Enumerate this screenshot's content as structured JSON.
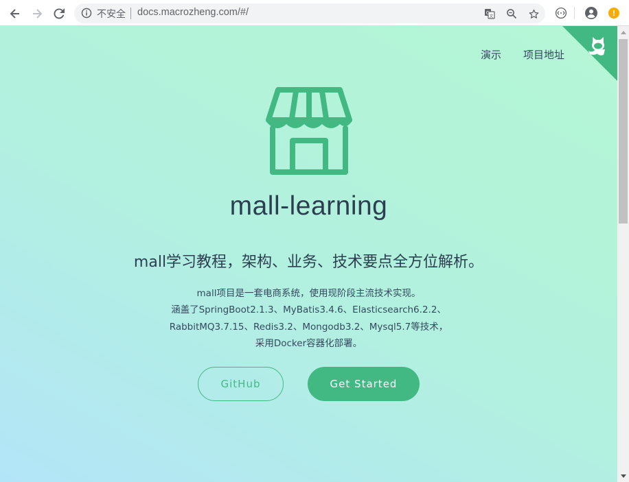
{
  "browser": {
    "security_label": "不安全",
    "url": "docs.macrozheng.com/#/",
    "profile_badge": "!"
  },
  "page": {
    "nav": {
      "demo": "演示",
      "project": "项目地址"
    },
    "title": "mall-learning",
    "tagline": "mall学习教程，架构、业务、技术要点全方位解析。",
    "description": [
      "mall项目是一套电商系统，使用现阶段主流技术实现。",
      "涵盖了SpringBoot2.1.3、MyBatis3.4.6、Elasticsearch6.2.2、",
      "RabbitMQ3.7.15、Redis3.2、Mongodb3.2、Mysql5.7等技术，",
      "采用Docker容器化部署。"
    ],
    "buttons": {
      "github": "GitHub",
      "get_started": "Get Started"
    }
  },
  "colors": {
    "accent": "#42b983",
    "text_dark": "#2c3e50",
    "text_body": "#34495e",
    "gradient_start": "#b3e5f8",
    "gradient_end": "#b4f6d6",
    "warning_badge": "#f9ab00"
  },
  "icons": {
    "back": "arrow-left-icon",
    "forward": "arrow-right-icon",
    "reload": "reload-icon",
    "info": "info-icon",
    "translate": "translate-icon",
    "zoom": "zoom-icon",
    "bookmark": "star-icon",
    "extension": "extension-icon",
    "profile": "account-icon",
    "logo": "storefront-icon",
    "corner": "github-octocat-icon"
  }
}
